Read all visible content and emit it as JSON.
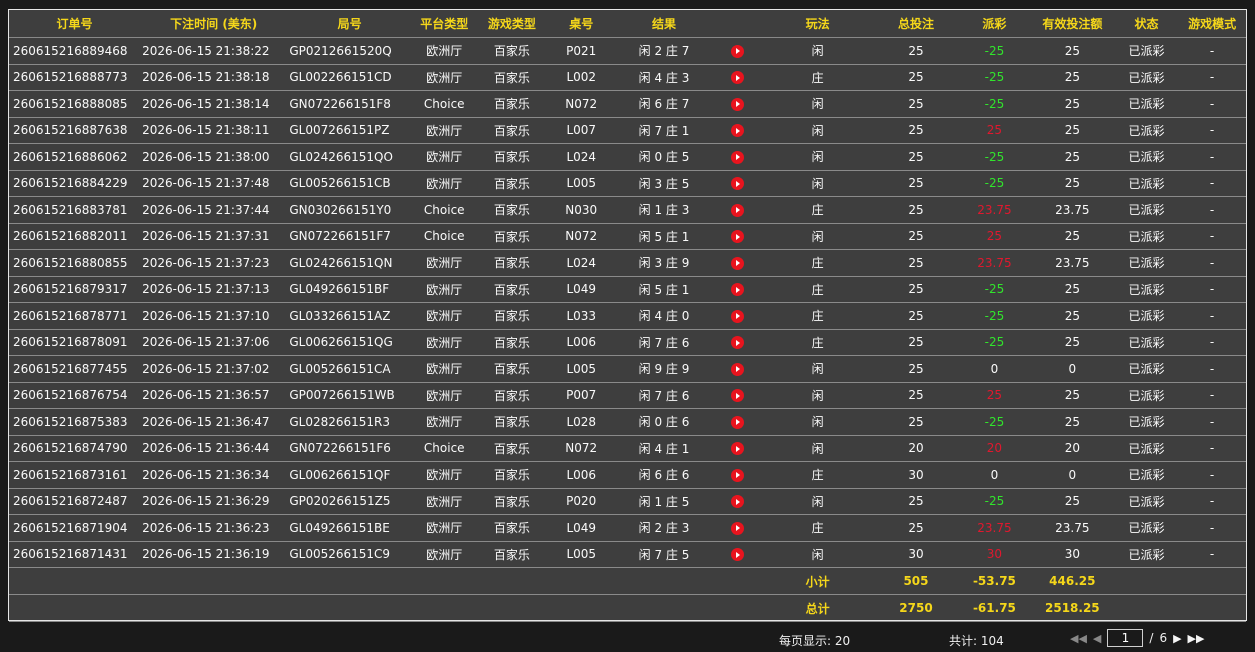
{
  "headers": [
    "订单号",
    "下注时间 (美东)",
    "局号",
    "平台类型",
    "游戏类型",
    "桌号",
    "结果",
    "",
    "玩法",
    "总投注",
    "派彩",
    "有效投注额",
    "状态",
    "游戏模式"
  ],
  "rows": [
    {
      "order": "260615216889468",
      "time": "2026-06-15 21:38:22",
      "round": "GP0212661520Q",
      "platform": "欧洲厅",
      "game": "百家乐",
      "table": "P021",
      "result": "闲 2 庄 7",
      "play": "闲",
      "bet": "25",
      "payout": "-25",
      "payout_sign": "neg",
      "valid": "25",
      "status": "已派彩",
      "mode": "-"
    },
    {
      "order": "260615216888773",
      "time": "2026-06-15 21:38:18",
      "round": "GL002266151CD",
      "platform": "欧洲厅",
      "game": "百家乐",
      "table": "L002",
      "result": "闲 4 庄 3",
      "play": "庄",
      "bet": "25",
      "payout": "-25",
      "payout_sign": "neg",
      "valid": "25",
      "status": "已派彩",
      "mode": "-"
    },
    {
      "order": "260615216888085",
      "time": "2026-06-15 21:38:14",
      "round": "GN072266151F8",
      "platform": "Choice",
      "game": "百家乐",
      "table": "N072",
      "result": "闲 6 庄 7",
      "play": "闲",
      "bet": "25",
      "payout": "-25",
      "payout_sign": "neg",
      "valid": "25",
      "status": "已派彩",
      "mode": "-"
    },
    {
      "order": "260615216887638",
      "time": "2026-06-15 21:38:11",
      "round": "GL007266151PZ",
      "platform": "欧洲厅",
      "game": "百家乐",
      "table": "L007",
      "result": "闲 7 庄 1",
      "play": "闲",
      "bet": "25",
      "payout": "25",
      "payout_sign": "pos",
      "valid": "25",
      "status": "已派彩",
      "mode": "-"
    },
    {
      "order": "260615216886062",
      "time": "2026-06-15 21:38:00",
      "round": "GL024266151QO",
      "platform": "欧洲厅",
      "game": "百家乐",
      "table": "L024",
      "result": "闲 0 庄 5",
      "play": "闲",
      "bet": "25",
      "payout": "-25",
      "payout_sign": "neg",
      "valid": "25",
      "status": "已派彩",
      "mode": "-"
    },
    {
      "order": "260615216884229",
      "time": "2026-06-15 21:37:48",
      "round": "GL005266151CB",
      "platform": "欧洲厅",
      "game": "百家乐",
      "table": "L005",
      "result": "闲 3 庄 5",
      "play": "闲",
      "bet": "25",
      "payout": "-25",
      "payout_sign": "neg",
      "valid": "25",
      "status": "已派彩",
      "mode": "-"
    },
    {
      "order": "260615216883781",
      "time": "2026-06-15 21:37:44",
      "round": "GN030266151Y0",
      "platform": "Choice",
      "game": "百家乐",
      "table": "N030",
      "result": "闲 1 庄 3",
      "play": "庄",
      "bet": "25",
      "payout": "23.75",
      "payout_sign": "pos",
      "valid": "23.75",
      "status": "已派彩",
      "mode": "-"
    },
    {
      "order": "260615216882011",
      "time": "2026-06-15 21:37:31",
      "round": "GN072266151F7",
      "platform": "Choice",
      "game": "百家乐",
      "table": "N072",
      "result": "闲 5 庄 1",
      "play": "闲",
      "bet": "25",
      "payout": "25",
      "payout_sign": "pos",
      "valid": "25",
      "status": "已派彩",
      "mode": "-"
    },
    {
      "order": "260615216880855",
      "time": "2026-06-15 21:37:23",
      "round": "GL024266151QN",
      "platform": "欧洲厅",
      "game": "百家乐",
      "table": "L024",
      "result": "闲 3 庄 9",
      "play": "庄",
      "bet": "25",
      "payout": "23.75",
      "payout_sign": "pos",
      "valid": "23.75",
      "status": "已派彩",
      "mode": "-"
    },
    {
      "order": "260615216879317",
      "time": "2026-06-15 21:37:13",
      "round": "GL049266151BF",
      "platform": "欧洲厅",
      "game": "百家乐",
      "table": "L049",
      "result": "闲 5 庄 1",
      "play": "庄",
      "bet": "25",
      "payout": "-25",
      "payout_sign": "neg",
      "valid": "25",
      "status": "已派彩",
      "mode": "-"
    },
    {
      "order": "260615216878771",
      "time": "2026-06-15 21:37:10",
      "round": "GL033266151AZ",
      "platform": "欧洲厅",
      "game": "百家乐",
      "table": "L033",
      "result": "闲 4 庄 0",
      "play": "庄",
      "bet": "25",
      "payout": "-25",
      "payout_sign": "neg",
      "valid": "25",
      "status": "已派彩",
      "mode": "-"
    },
    {
      "order": "260615216878091",
      "time": "2026-06-15 21:37:06",
      "round": "GL006266151QG",
      "platform": "欧洲厅",
      "game": "百家乐",
      "table": "L006",
      "result": "闲 7 庄 6",
      "play": "庄",
      "bet": "25",
      "payout": "-25",
      "payout_sign": "neg",
      "valid": "25",
      "status": "已派彩",
      "mode": "-"
    },
    {
      "order": "260615216877455",
      "time": "2026-06-15 21:37:02",
      "round": "GL005266151CA",
      "platform": "欧洲厅",
      "game": "百家乐",
      "table": "L005",
      "result": "闲 9 庄 9",
      "play": "闲",
      "bet": "25",
      "payout": "0",
      "payout_sign": "zero",
      "valid": "0",
      "status": "已派彩",
      "mode": "-"
    },
    {
      "order": "260615216876754",
      "time": "2026-06-15 21:36:57",
      "round": "GP007266151WB",
      "platform": "欧洲厅",
      "game": "百家乐",
      "table": "P007",
      "result": "闲 7 庄 6",
      "play": "闲",
      "bet": "25",
      "payout": "25",
      "payout_sign": "pos",
      "valid": "25",
      "status": "已派彩",
      "mode": "-"
    },
    {
      "order": "260615216875383",
      "time": "2026-06-15 21:36:47",
      "round": "GL028266151R3",
      "platform": "欧洲厅",
      "game": "百家乐",
      "table": "L028",
      "result": "闲 0 庄 6",
      "play": "闲",
      "bet": "25",
      "payout": "-25",
      "payout_sign": "neg",
      "valid": "25",
      "status": "已派彩",
      "mode": "-"
    },
    {
      "order": "260615216874790",
      "time": "2026-06-15 21:36:44",
      "round": "GN072266151F6",
      "platform": "Choice",
      "game": "百家乐",
      "table": "N072",
      "result": "闲 4 庄 1",
      "play": "闲",
      "bet": "20",
      "payout": "20",
      "payout_sign": "pos",
      "valid": "20",
      "status": "已派彩",
      "mode": "-"
    },
    {
      "order": "260615216873161",
      "time": "2026-06-15 21:36:34",
      "round": "GL006266151QF",
      "platform": "欧洲厅",
      "game": "百家乐",
      "table": "L006",
      "result": "闲 6 庄 6",
      "play": "庄",
      "bet": "30",
      "payout": "0",
      "payout_sign": "zero",
      "valid": "0",
      "status": "已派彩",
      "mode": "-"
    },
    {
      "order": "260615216872487",
      "time": "2026-06-15 21:36:29",
      "round": "GP020266151Z5",
      "platform": "欧洲厅",
      "game": "百家乐",
      "table": "P020",
      "result": "闲 1 庄 5",
      "play": "闲",
      "bet": "25",
      "payout": "-25",
      "payout_sign": "neg",
      "valid": "25",
      "status": "已派彩",
      "mode": "-"
    },
    {
      "order": "260615216871904",
      "time": "2026-06-15 21:36:23",
      "round": "GL049266151BE",
      "platform": "欧洲厅",
      "game": "百家乐",
      "table": "L049",
      "result": "闲 2 庄 3",
      "play": "庄",
      "bet": "25",
      "payout": "23.75",
      "payout_sign": "pos",
      "valid": "23.75",
      "status": "已派彩",
      "mode": "-"
    },
    {
      "order": "260615216871431",
      "time": "2026-06-15 21:36:19",
      "round": "GL005266151C9",
      "platform": "欧洲厅",
      "game": "百家乐",
      "table": "L005",
      "result": "闲 7 庄 5",
      "play": "闲",
      "bet": "30",
      "payout": "30",
      "payout_sign": "pos",
      "valid": "30",
      "status": "已派彩",
      "mode": "-"
    }
  ],
  "subtotal": {
    "label": "小计",
    "bet": "505",
    "payout": "-53.75",
    "valid": "446.25"
  },
  "total": {
    "label": "总计",
    "bet": "2750",
    "payout": "-61.75",
    "valid": "2518.25"
  },
  "pager": {
    "per_page": "每页显示: 20",
    "total_count": "共计: 104",
    "current_page": "1",
    "separator": "/",
    "total_pages": "6"
  }
}
